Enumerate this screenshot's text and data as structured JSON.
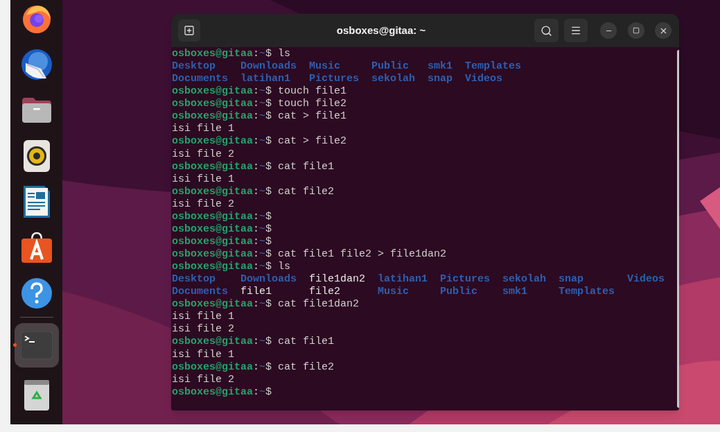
{
  "dock": [
    {
      "kind": "firefox",
      "running": false,
      "selected": false
    },
    {
      "kind": "thunderbird",
      "running": false,
      "selected": false
    },
    {
      "kind": "files",
      "running": false,
      "selected": false
    },
    {
      "kind": "rhythmbox",
      "running": false,
      "selected": false
    },
    {
      "kind": "writer",
      "running": false,
      "selected": false
    },
    {
      "kind": "software",
      "running": false,
      "selected": false
    },
    {
      "kind": "help",
      "running": false,
      "selected": false
    },
    {
      "kind": "separator"
    },
    {
      "kind": "terminal",
      "running": true,
      "selected": true
    },
    {
      "kind": "trash",
      "running": false,
      "selected": false
    }
  ],
  "window": {
    "title": "osboxes@gitaa: ~"
  },
  "terminal": {
    "lines": [
      {
        "kind": "prompt",
        "user_host": "osboxes@gitaa",
        "separator": ":",
        "path": "~",
        "symbol": "$",
        "command": "ls"
      },
      {
        "kind": "listing",
        "columns": [
          [
            {
              "text": "Desktop",
              "kind": "dir"
            },
            {
              "text": "Documents",
              "kind": "dir"
            }
          ],
          [
            {
              "text": "Downloads",
              "kind": "dir"
            },
            {
              "text": "latihan1",
              "kind": "dir"
            }
          ],
          [
            {
              "text": "Music",
              "kind": "dir"
            },
            {
              "text": "Pictures",
              "kind": "dir"
            }
          ],
          [
            {
              "text": "Public",
              "kind": "dir"
            },
            {
              "text": "sekolah",
              "kind": "dir"
            }
          ],
          [
            {
              "text": "smk1",
              "kind": "dir"
            },
            {
              "text": "snap",
              "kind": "dir"
            }
          ],
          [
            {
              "text": "Templates",
              "kind": "dir"
            },
            {
              "text": "Videos",
              "kind": "dir"
            }
          ]
        ]
      },
      {
        "kind": "prompt",
        "user_host": "osboxes@gitaa",
        "separator": ":",
        "path": "~",
        "symbol": "$",
        "command": "touch file1"
      },
      {
        "kind": "prompt",
        "user_host": "osboxes@gitaa",
        "separator": ":",
        "path": "~",
        "symbol": "$",
        "command": "touch file2"
      },
      {
        "kind": "prompt",
        "user_host": "osboxes@gitaa",
        "separator": ":",
        "path": "~",
        "symbol": "$",
        "command": "cat > file1"
      },
      {
        "kind": "output",
        "text": "isi file 1"
      },
      {
        "kind": "prompt",
        "user_host": "osboxes@gitaa",
        "separator": ":",
        "path": "~",
        "symbol": "$",
        "command": "cat > file2"
      },
      {
        "kind": "output",
        "text": "isi file 2"
      },
      {
        "kind": "prompt",
        "user_host": "osboxes@gitaa",
        "separator": ":",
        "path": "~",
        "symbol": "$",
        "command": "cat file1"
      },
      {
        "kind": "output",
        "text": "isi file 1"
      },
      {
        "kind": "prompt",
        "user_host": "osboxes@gitaa",
        "separator": ":",
        "path": "~",
        "symbol": "$",
        "command": "cat file2"
      },
      {
        "kind": "output",
        "text": "isi file 2"
      },
      {
        "kind": "prompt",
        "user_host": "osboxes@gitaa",
        "separator": ":",
        "path": "~",
        "symbol": "$"
      },
      {
        "kind": "prompt",
        "user_host": "osboxes@gitaa",
        "separator": ":",
        "path": "~",
        "symbol": "$"
      },
      {
        "kind": "prompt",
        "user_host": "osboxes@gitaa",
        "separator": ":",
        "path": "~",
        "symbol": "$"
      },
      {
        "kind": "prompt",
        "user_host": "osboxes@gitaa",
        "separator": ":",
        "path": "~",
        "symbol": "$",
        "command": "cat file1 file2 > file1dan2"
      },
      {
        "kind": "prompt",
        "user_host": "osboxes@gitaa",
        "separator": ":",
        "path": "~",
        "symbol": "$",
        "command": "ls"
      },
      {
        "kind": "listing",
        "columns": [
          [
            {
              "text": "Desktop",
              "kind": "dir"
            },
            {
              "text": "Documents",
              "kind": "dir"
            }
          ],
          [
            {
              "text": "Downloads",
              "kind": "dir"
            },
            {
              "text": "file1",
              "kind": "file"
            }
          ],
          [
            {
              "text": "file1dan2",
              "kind": "file"
            },
            {
              "text": "file2",
              "kind": "file"
            }
          ],
          [
            {
              "text": "latihan1",
              "kind": "dir"
            },
            {
              "text": "Music",
              "kind": "dir"
            }
          ],
          [
            {
              "text": "Pictures",
              "kind": "dir"
            },
            {
              "text": "Public",
              "kind": "dir"
            }
          ],
          [
            {
              "text": "sekolah",
              "kind": "dir"
            },
            {
              "text": "smk1",
              "kind": "dir"
            }
          ],
          [
            {
              "text": "snap",
              "kind": "dir"
            },
            {
              "text": "Templates",
              "kind": "dir"
            }
          ],
          [
            {
              "text": "Videos",
              "kind": "dir"
            }
          ]
        ]
      },
      {
        "kind": "prompt",
        "user_host": "osboxes@gitaa",
        "separator": ":",
        "path": "~",
        "symbol": "$",
        "command": "cat file1dan2"
      },
      {
        "kind": "output",
        "text": "isi file 1"
      },
      {
        "kind": "output",
        "text": "isi file 2"
      },
      {
        "kind": "prompt",
        "user_host": "osboxes@gitaa",
        "separator": ":",
        "path": "~",
        "symbol": "$",
        "command": "cat file1"
      },
      {
        "kind": "output",
        "text": "isi file 1"
      },
      {
        "kind": "prompt",
        "user_host": "osboxes@gitaa",
        "separator": ":",
        "path": "~",
        "symbol": "$",
        "command": "cat file2"
      },
      {
        "kind": "output",
        "text": "isi file 2"
      },
      {
        "kind": "prompt",
        "user_host": "osboxes@gitaa",
        "separator": ":",
        "path": "~",
        "symbol": "$"
      }
    ]
  }
}
